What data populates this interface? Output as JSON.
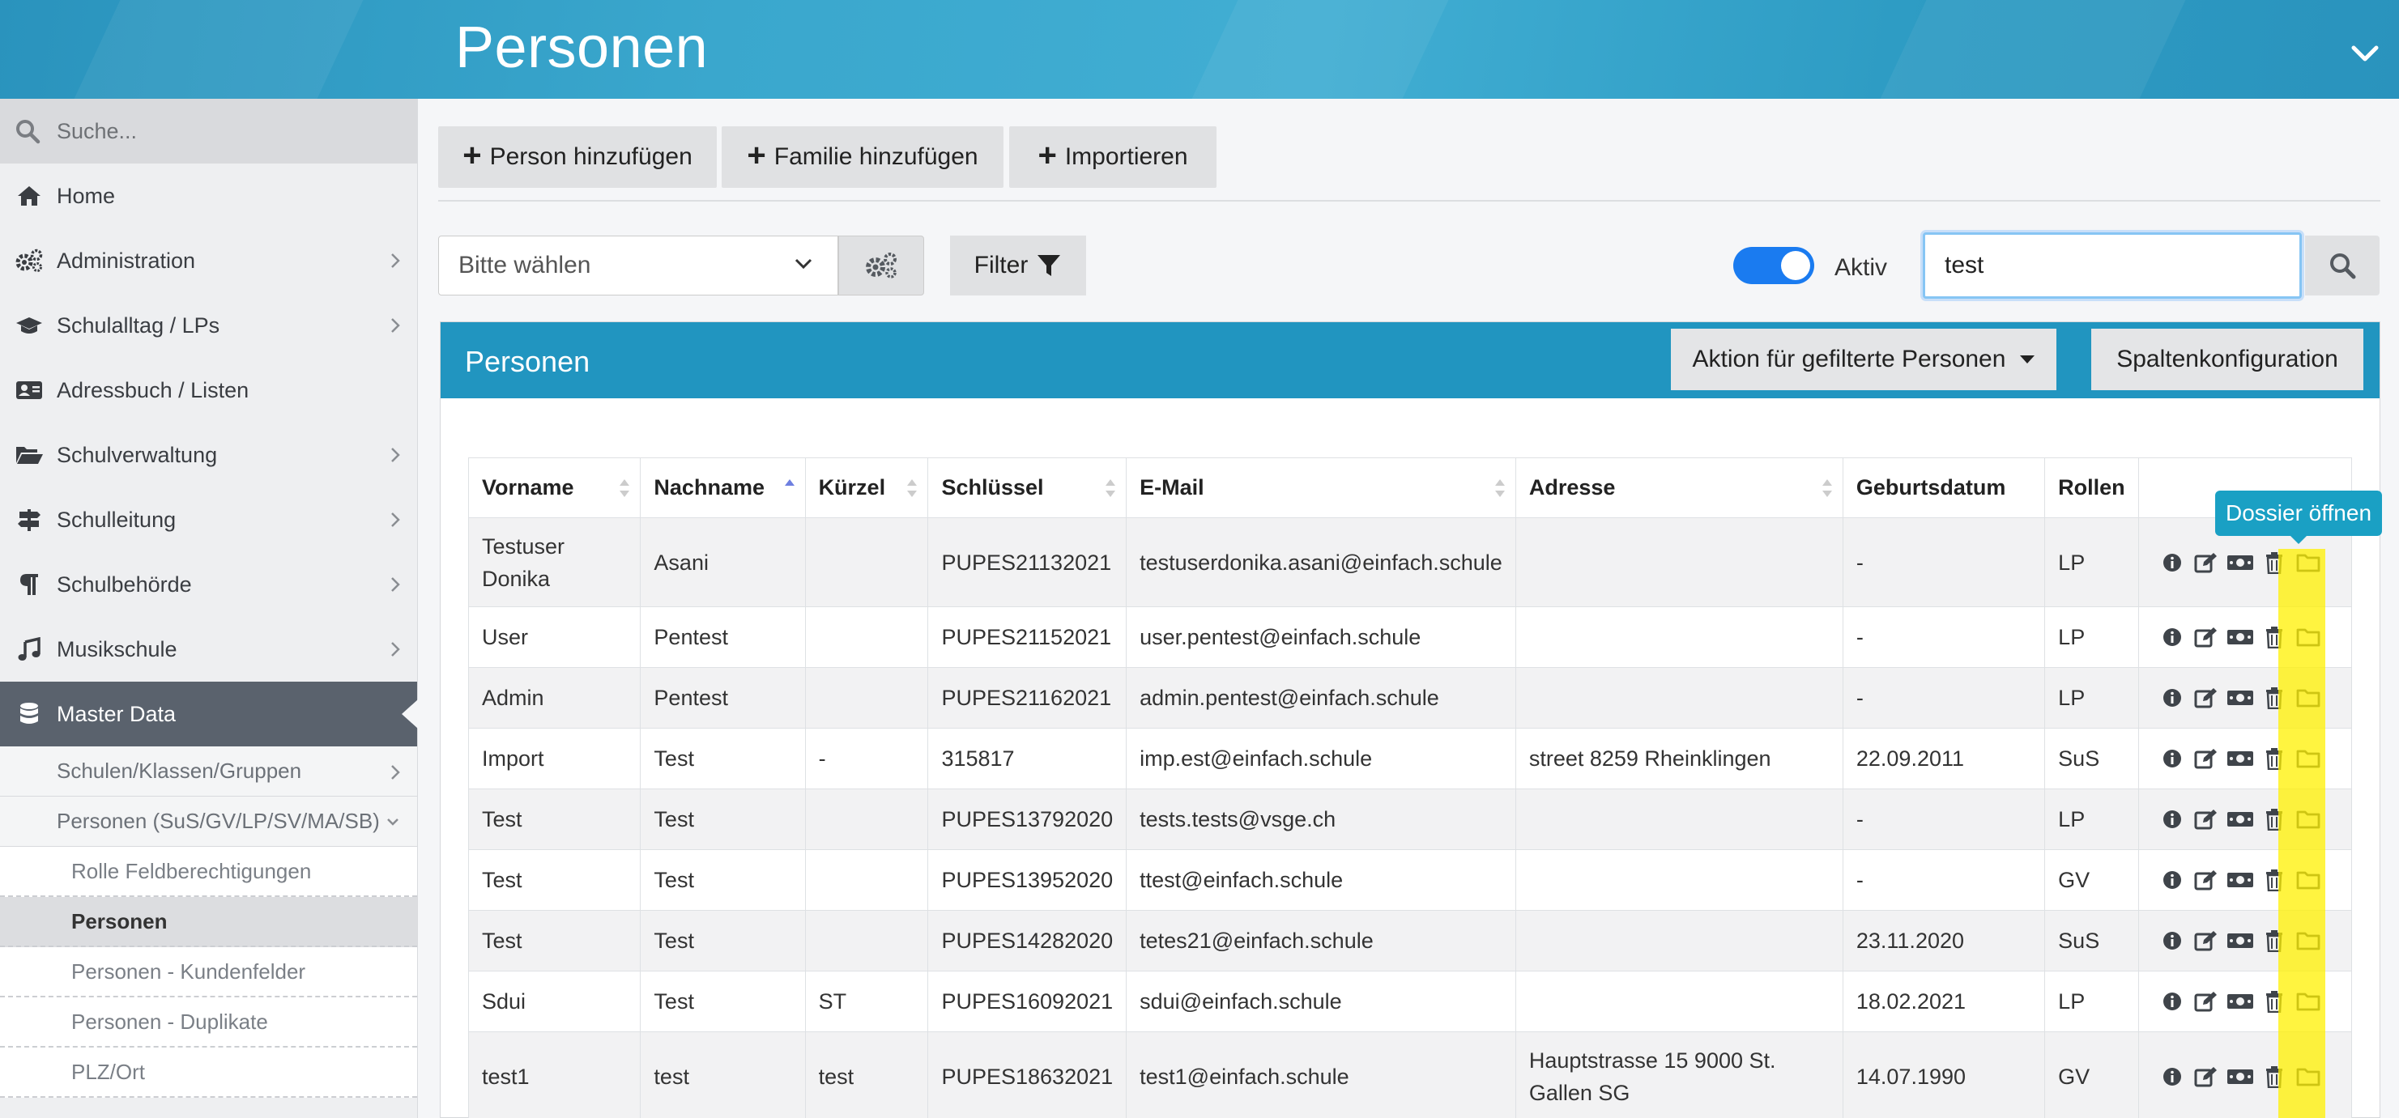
{
  "header": {
    "title": "Personen"
  },
  "sidebar": {
    "search_placeholder": "Suche...",
    "items": [
      {
        "label": "Home",
        "icon": "home-icon",
        "arrow": false
      },
      {
        "label": "Administration",
        "icon": "gears-icon",
        "arrow": true
      },
      {
        "label": "Schulalltag / LPs",
        "icon": "graduation-cap-icon",
        "arrow": true
      },
      {
        "label": "Adressbuch / Listen",
        "icon": "address-card-icon",
        "arrow": false
      },
      {
        "label": "Schulverwaltung",
        "icon": "folder-open-icon",
        "arrow": true
      },
      {
        "label": "Schulleitung",
        "icon": "signpost-icon",
        "arrow": true
      },
      {
        "label": "Schulbehörde",
        "icon": "paragraph-icon",
        "arrow": true
      },
      {
        "label": "Musikschule",
        "icon": "music-icon",
        "arrow": true
      },
      {
        "label": "Master Data",
        "icon": "database-icon",
        "arrow": false
      }
    ],
    "sub_items": [
      {
        "label": "Schulen/Klassen/Gruppen"
      },
      {
        "label": "Personen (SuS/GV/LP/SV/MA/SB)"
      }
    ],
    "sub_sub_items": [
      {
        "label": "Rolle Feldberechtigungen"
      },
      {
        "label": "Personen"
      },
      {
        "label": "Personen - Kundenfelder"
      },
      {
        "label": "Personen - Duplikate"
      },
      {
        "label": "PLZ/Ort"
      }
    ]
  },
  "toolbar": {
    "add_person": "Person hinzufügen",
    "add_family": "Familie hinzufügen",
    "import": "Importieren"
  },
  "filters": {
    "select_placeholder": "Bitte wählen",
    "filter_label": "Filter",
    "toggle_label": "Aktiv",
    "toggle_on": true,
    "search_value": "test"
  },
  "panel": {
    "title": "Personen",
    "action_button": "Aktion für gefilterte Personen",
    "columns_button": "Spaltenkonfiguration"
  },
  "table": {
    "headers": [
      "Vorname",
      "Nachname",
      "Kürzel",
      "Schlüssel",
      "E-Mail",
      "Adresse",
      "Geburtsdatum",
      "Rollen"
    ],
    "rows": [
      [
        "Testuser Donika",
        "Asani",
        "",
        "PUPES21132021",
        "testuserdonika.asani@einfach.schule",
        "",
        "-",
        "LP"
      ],
      [
        "User",
        "Pentest",
        "",
        "PUPES21152021",
        "user.pentest@einfach.schule",
        "",
        "-",
        "LP"
      ],
      [
        "Admin",
        "Pentest",
        "",
        "PUPES21162021",
        "admin.pentest@einfach.schule",
        "",
        "-",
        "LP"
      ],
      [
        "Import",
        "Test",
        "-",
        "315817",
        "imp.est@einfach.schule",
        "street 8259 Rheinklingen",
        "22.09.2011",
        "SuS"
      ],
      [
        "Test",
        "Test",
        "",
        "PUPES13792020",
        "tests.tests@vsge.ch",
        "",
        "-",
        "LP"
      ],
      [
        "Test",
        "Test",
        "",
        "PUPES13952020",
        "ttest@einfach.schule",
        "",
        "-",
        "GV"
      ],
      [
        "Test",
        "Test",
        "",
        "PUPES14282020",
        "tetes21@einfach.schule",
        "",
        "23.11.2020",
        "SuS"
      ],
      [
        "Sdui",
        "Test",
        "ST",
        "PUPES16092021",
        "sdui@einfach.schule",
        "",
        "18.02.2021",
        "LP"
      ],
      [
        "test1",
        "test",
        "test",
        "PUPES18632021",
        "test1@einfach.schule",
        "Hauptstrasse 15 9000 St. Gallen SG",
        "14.07.1990",
        "GV"
      ]
    ],
    "row_actions": [
      "info-icon",
      "edit-icon",
      "money-icon",
      "trash-icon",
      "folder-icon"
    ]
  },
  "tooltip": {
    "text": "Dossier öffnen"
  },
  "colors": {
    "accent": "#2195c0",
    "toggle": "#1a7bf0",
    "highlight": "#fff000",
    "nav_active": "#5a626d"
  }
}
